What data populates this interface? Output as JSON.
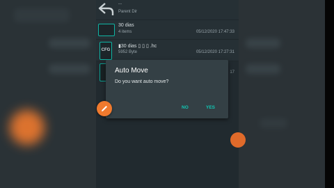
{
  "file_list": {
    "items": [
      {
        "type": "parent",
        "dots": "...",
        "label": "Parent Dir"
      },
      {
        "type": "folder",
        "name": "30 dias",
        "sub": "4 items",
        "date": "05/12/2020 17:47:33"
      },
      {
        "type": "file",
        "icon_text": "CFG",
        "name": "▮30 dias ▯ ▯ ▯ .hc",
        "sub": "5952 Byte",
        "date": "05/12/2020 17:27:31"
      },
      {
        "type": "file",
        "icon_text": "",
        "name": "",
        "sub": "",
        "date": "17"
      }
    ]
  },
  "dialog": {
    "title": "Auto Move",
    "message": "Do you want auto move?",
    "no_label": "NO",
    "yes_label": "YES"
  },
  "colors": {
    "accent": "#11c6b3",
    "fab": "#f07a2e",
    "background": "#263035"
  },
  "icons": {
    "back": "back-arrow-icon",
    "folder": "folder-icon",
    "file": "file-icon",
    "fab": "pencil-icon"
  }
}
